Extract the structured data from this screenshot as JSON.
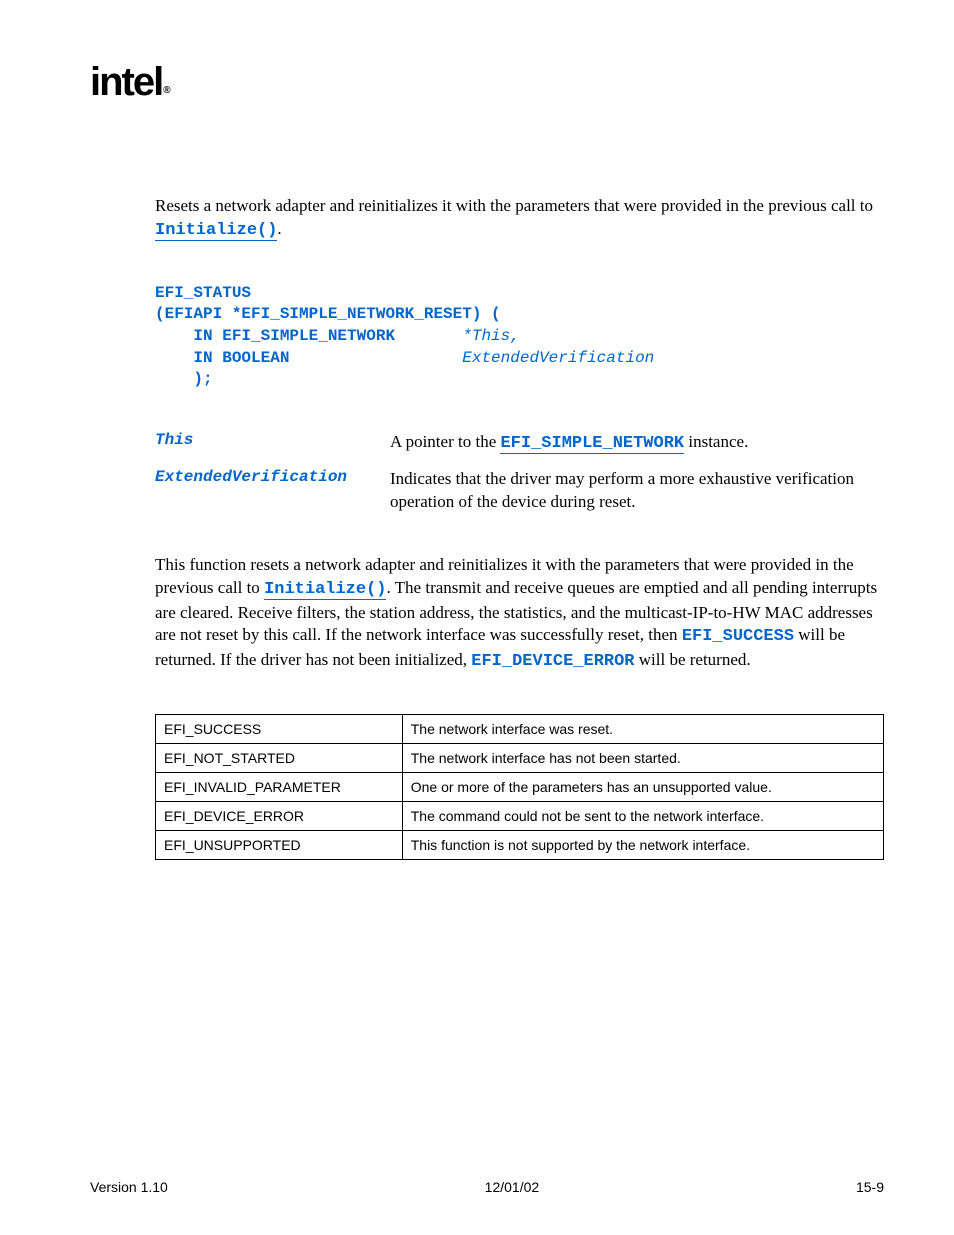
{
  "logo": "intel",
  "intro": {
    "text1": "Resets a network adapter and reinitializes it with the parameters that were provided in the previous call to ",
    "link": "Initialize()",
    "text2": "."
  },
  "code": {
    "l1a": "EFI_STATUS",
    "l2a": "(EFIAPI *EFI_SIMPLE_NETWORK_RESET) (",
    "l3a": "    IN EFI_SIMPLE_NETWORK       ",
    "l3b": "*This,",
    "l4a": "    IN BOOLEAN                  ",
    "l4b": "ExtendedVerification",
    "l5a": "    );"
  },
  "params": [
    {
      "name": "This",
      "desc_pre": "A pointer to the ",
      "desc_link": "EFI_SIMPLE_NETWORK",
      "desc_post": " instance."
    },
    {
      "name": "ExtendedVerification",
      "desc": "Indicates that the driver may perform a more exhaustive verification operation of the device during reset."
    }
  ],
  "description": {
    "t1": "This function resets a network adapter and reinitializes it with the parameters that were provided in the previous call to ",
    "link1": "Initialize()",
    "t2": ".  The transmit and receive queues are emptied and all pending interrupts are cleared.  Receive filters, the station address, the statistics, and the multicast-IP-to-HW MAC addresses are not reset by this call.  If the network interface was successfully reset, then ",
    "code1": "EFI_SUCCESS",
    "t3": " will be returned. If the driver has not been initialized, ",
    "code2": "EFI_DEVICE_ERROR",
    "t4": " will be returned."
  },
  "status_table": [
    {
      "code": "EFI_SUCCESS",
      "desc": "The network interface was reset."
    },
    {
      "code": "EFI_NOT_STARTED",
      "desc": "The network interface has not been started."
    },
    {
      "code": "EFI_INVALID_PARAMETER",
      "desc": "One or more of the parameters has an unsupported value."
    },
    {
      "code": "EFI_DEVICE_ERROR",
      "desc": "The command could not be sent to the network interface."
    },
    {
      "code": "EFI_UNSUPPORTED",
      "desc": "This function is not supported by the network interface."
    }
  ],
  "footer": {
    "version": "Version 1.10",
    "date": "12/01/02",
    "page": "15-9"
  }
}
